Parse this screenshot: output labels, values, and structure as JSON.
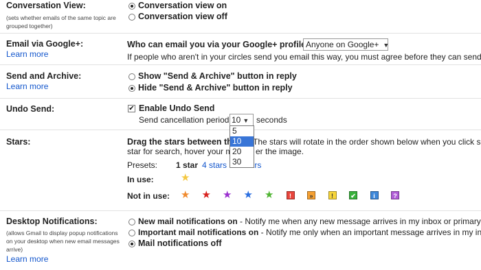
{
  "conversation": {
    "label": "Conversation View:",
    "sub": "(sets whether emails of the same topic are grouped together)",
    "opt_on": "Conversation view on",
    "opt_off": "Conversation view off",
    "selected": "on"
  },
  "google_plus": {
    "label": "Email via Google+:",
    "learn": "Learn more",
    "question": "Who can email you via your Google+ profile?",
    "select_value": "Anyone on Google+",
    "desc": "If people who aren't in your circles send you email this way, you must agree before they can send you"
  },
  "send_archive": {
    "label": "Send and Archive:",
    "learn": "Learn more",
    "opt_show": "Show \"Send & Archive\" button in reply",
    "opt_hide": "Hide \"Send & Archive\" button in reply",
    "selected": "hide"
  },
  "undo_send": {
    "label": "Undo Send:",
    "checkbox_label": "Enable Undo Send",
    "checked": true,
    "period_label": "Send cancellation period:",
    "period_value": "10",
    "period_unit": "seconds",
    "options": [
      "5",
      "10",
      "20",
      "30"
    ],
    "selected_option": "10"
  },
  "stars": {
    "label": "Stars:",
    "drag_text_a": "Drag the stars between the",
    "drag_text_b": "The stars will rotate in the order shown below when you click succ",
    "line2_a": "star for search, hover your mo",
    "line2_b": "er the image.",
    "presets_label": "Presets:",
    "preset_1": "1 star",
    "preset_4": "4 stars",
    "preset_all": "all stars",
    "in_use_label": "In use:",
    "not_in_use_label": "Not in use:",
    "in_use": [
      {
        "icon": "yellow-star-icon",
        "color": "#f4c842"
      }
    ],
    "not_in_use": [
      {
        "icon": "orange-star-icon",
        "color": "#f08a2e"
      },
      {
        "icon": "red-star-icon",
        "color": "#d8221f"
      },
      {
        "icon": "purple-star-icon",
        "color": "#9a2fcf"
      },
      {
        "icon": "blue-star-icon",
        "color": "#2a6ee0"
      },
      {
        "icon": "green-star-icon",
        "color": "#4fb432"
      },
      {
        "icon": "red-bang-icon",
        "color": "#e8453c",
        "glyph": "!"
      },
      {
        "icon": "orange-guillemet-icon",
        "color": "#f5a032",
        "glyph": "»"
      },
      {
        "icon": "yellow-bang-icon",
        "color": "#f7d53a",
        "glyph": "!"
      },
      {
        "icon": "green-check-icon",
        "color": "#39b13c",
        "glyph": "✔"
      },
      {
        "icon": "blue-info-icon",
        "color": "#3d87d9",
        "glyph": "i"
      },
      {
        "icon": "purple-question-icon",
        "color": "#b05cd6",
        "glyph": "?"
      }
    ]
  },
  "desktop": {
    "label": "Desktop Notifications:",
    "sub1": "(allows Gmail to display popup notifications",
    "sub2": "on your desktop when new email messages",
    "sub3": "arrive)",
    "learn": "Learn more",
    "opt_new": "New mail notifications on",
    "opt_new_desc": " - Notify me when any new message arrives in my inbox or primary tab",
    "opt_important": "Important mail notifications on",
    "opt_important_desc": " - Notify me only when an important message arrives in my inbox",
    "opt_off": "Mail notifications off",
    "selected": "off"
  }
}
